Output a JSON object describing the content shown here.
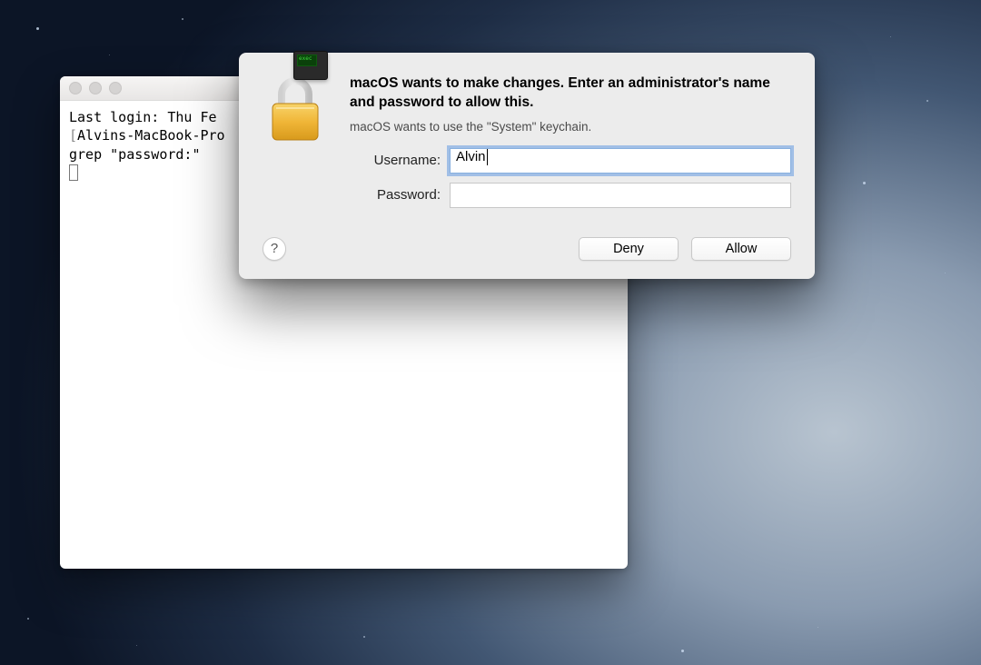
{
  "terminal": {
    "line1": "Last login: Thu Fe",
    "line2": "Alvins-MacBook-Pro",
    "line3": "grep \"password:\""
  },
  "dialog": {
    "heading": "macOS wants to make changes. Enter an administrator's name and password to allow this.",
    "subtext": "macOS wants to use the \"System\" keychain.",
    "username_label": "Username:",
    "password_label": "Password:",
    "username_value": "Alvin",
    "password_value": "",
    "help_label": "?",
    "deny_label": "Deny",
    "allow_label": "Allow"
  }
}
